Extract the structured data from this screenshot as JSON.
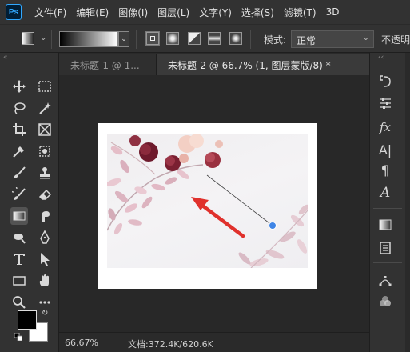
{
  "app": {
    "logo": "Ps"
  },
  "menu": [
    "文件(F)",
    "编辑(E)",
    "图像(I)",
    "图层(L)",
    "文字(Y)",
    "选择(S)",
    "滤镜(T)",
    "3D"
  ],
  "options": {
    "mode_label": "模式:",
    "mode_value": "正常",
    "opacity_label": "不透明"
  },
  "tabs": [
    {
      "label": "未标题-1 @ 1...",
      "active": false
    },
    {
      "label": "未标题-2 @ 66.7% (1, 图层蒙版/8) *",
      "active": true
    }
  ],
  "status": {
    "zoom": "66.67%",
    "doc": "文档:372.4K/620.6K"
  },
  "toolbar": {
    "collapse": "«",
    "tools": [
      "move-tool",
      "marquee-tool",
      "lasso-tool",
      "quick-select-tool",
      "crop-tool",
      "frame-tool",
      "eyedropper-tool",
      "healing-tool",
      "brush-tool",
      "stamp-tool",
      "history-brush-tool",
      "eraser-tool",
      "gradient-tool",
      "smudge-tool",
      "dodge-tool",
      "pen-tool",
      "type-tool",
      "path-select-tool",
      "rectangle-tool",
      "hand-tool",
      "zoom-tool",
      "more-tools"
    ],
    "foreground_color": "#000000",
    "background_color": "#ffffff"
  },
  "colors": {
    "arrow": "#e0312c",
    "handle": "#3f85e6"
  }
}
